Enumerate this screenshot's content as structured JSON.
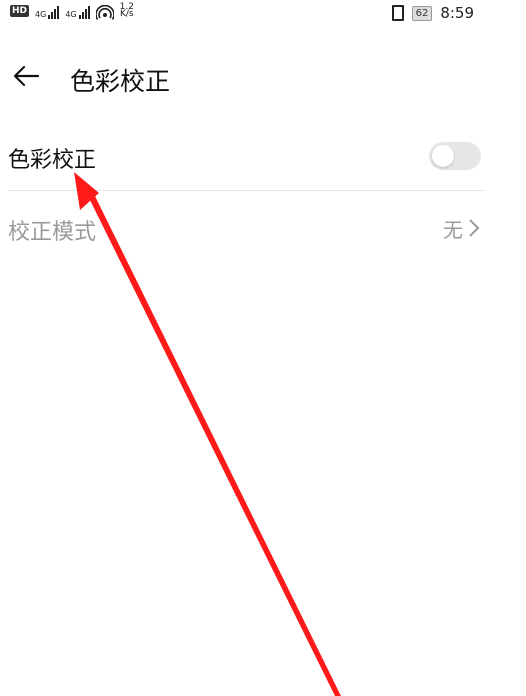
{
  "status_bar": {
    "hd": "HD",
    "sim1": "4G",
    "sim2": "4G",
    "speed_value": "1.2",
    "speed_unit": "K/s",
    "battery": "62",
    "time": "8:59"
  },
  "header": {
    "title": "色彩校正"
  },
  "settings": {
    "color_correction_label": "色彩校正",
    "color_correction_enabled": false,
    "correction_mode_label": "校正模式",
    "correction_mode_value": "无"
  },
  "colors": {
    "annotation_arrow": "#ff1a1a",
    "disabled_text": "#9a9a9a",
    "toggle_track": "#e6e6e6"
  }
}
